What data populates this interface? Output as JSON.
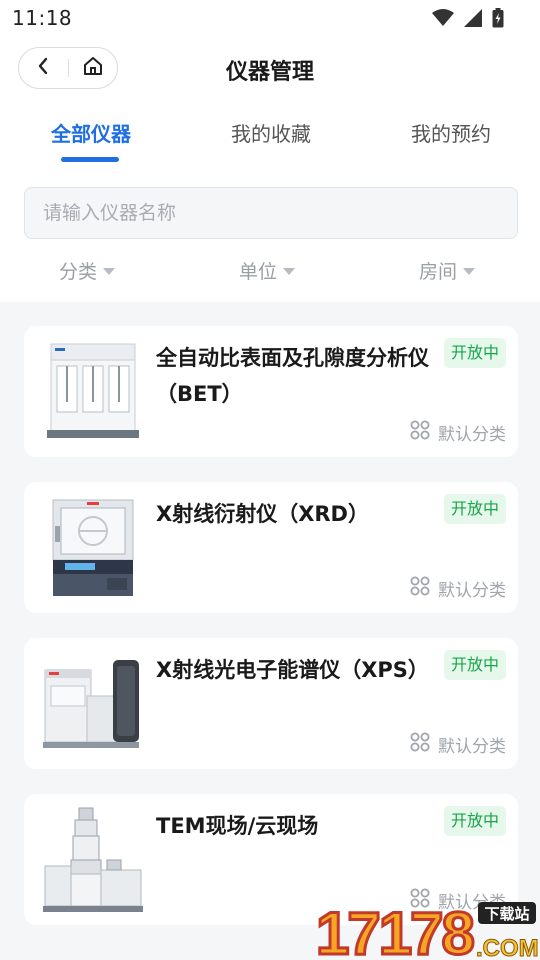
{
  "status_bar": {
    "time": "11:18"
  },
  "header": {
    "title": "仪器管理"
  },
  "tabs": [
    {
      "label": "全部仪器",
      "active": true
    },
    {
      "label": "我的收藏",
      "active": false
    },
    {
      "label": "我的预约",
      "active": false
    }
  ],
  "search": {
    "placeholder": "请输入仪器名称",
    "value": ""
  },
  "filters": [
    {
      "label": "分类"
    },
    {
      "label": "单位"
    },
    {
      "label": "房间"
    }
  ],
  "instruments": [
    {
      "name": "全自动比表面及孔隙度分析仪（BET）",
      "status": "开放中",
      "category": "默认分类",
      "image_icon": "bet-analyzer-icon"
    },
    {
      "name": "X射线衍射仪（XRD）",
      "status": "开放中",
      "category": "默认分类",
      "image_icon": "xrd-diffractometer-icon"
    },
    {
      "name": "X射线光电子能谱仪（XPS）",
      "status": "开放中",
      "category": "默认分类",
      "image_icon": "xps-spectrometer-icon"
    },
    {
      "name": "TEM现场/云现场",
      "status": "开放中",
      "category": "默认分类",
      "image_icon": "tem-microscope-icon"
    }
  ],
  "watermark": {
    "number": "17178",
    "badge": "下载站",
    "domain": ".COM"
  },
  "colors": {
    "accent": "#1f6fe0",
    "status_green": "#1aa64b",
    "status_bg": "#e6f7ec"
  }
}
